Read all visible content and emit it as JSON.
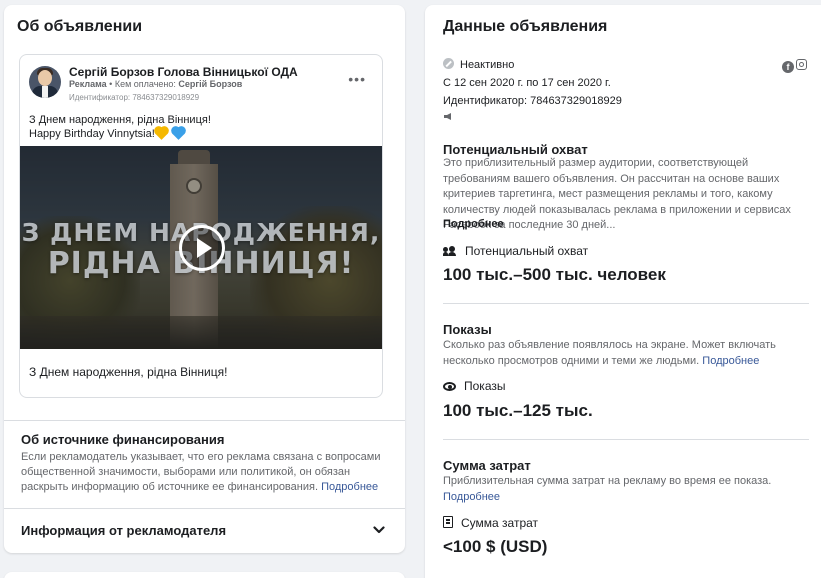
{
  "left": {
    "title": "Об объявлении",
    "ad": {
      "page_name": "Сергій Борзов Голова Вінницької ОДА",
      "sponsored_label": "Реклама",
      "paid_by_prefix": " • Кем оплачено: ",
      "paid_by_name": "Сергій Борзов",
      "id_line": "Идентификатор: 784637329018929",
      "text_line1": "З Днем народження, рідна Вінниця!",
      "text_line2": "Happy Birthday Vinnytsia!",
      "video_line1": "З ДНЕМ НАРОДЖЕННЯ,",
      "video_line2": "РІДНА ВІННИЦЯ!",
      "caption": "З Днем народження, рідна Вінниця!"
    },
    "funding": {
      "title": "Об источнике финансирования",
      "text": "Если рекламодатель указывает, что его реклама связана с вопросами общественной значимости, выборами или политикой, он обязан раскрыть информацию об источнике ее финансирования.",
      "more": "Подробнее"
    },
    "advertiser_info": "Информация от рекламодателя"
  },
  "right": {
    "title": "Данные объявления",
    "status": "Неактивно",
    "date_range": "С 12 сен 2020 г. по 17 сен 2020 г.",
    "ad_id": "Идентификатор: 784637329018929",
    "reach": {
      "heading": "Потенциальный охват",
      "desc": "Это приблизительный размер аудитории, соответствующей требованиям вашего объявления. Он рассчитан на основе ваших критериев таргетинга, мест размещения рекламы и того, какому количеству людей показывалась реклама в приложении и сервисах Facebook за последние 30 дней...",
      "more": "Подробнее",
      "label": "Потенциальный охват",
      "value": "100 тыс.–500 тыс. человек"
    },
    "impressions": {
      "heading": "Показы",
      "desc": "Сколько раз объявление появлялось на экране. Может включать несколько просмотров одними и теми же людьми.",
      "more": "Подробнее",
      "label": "Показы",
      "value": "100 тыс.–125 тыс."
    },
    "spend": {
      "heading": "Сумма затрат",
      "desc": "Приблизительная сумма затрат на рекламу во время ее показа.",
      "more": "Подробнее",
      "label": "Сумма затрат",
      "value": "<100 $ (USD)"
    }
  },
  "icons": [
    "avatar",
    "more-dots-icon",
    "heart-yellow-icon",
    "heart-blue-icon",
    "play-icon",
    "chevron-down-icon",
    "status-inactive-icon",
    "facebook-icon",
    "instagram-icon",
    "megaphone-icon",
    "people-icon",
    "eye-icon",
    "money-icon"
  ],
  "colors": {
    "link": "#385898",
    "muted": "#65676b",
    "text": "#1c1e21",
    "background": "#f0f2f5"
  }
}
